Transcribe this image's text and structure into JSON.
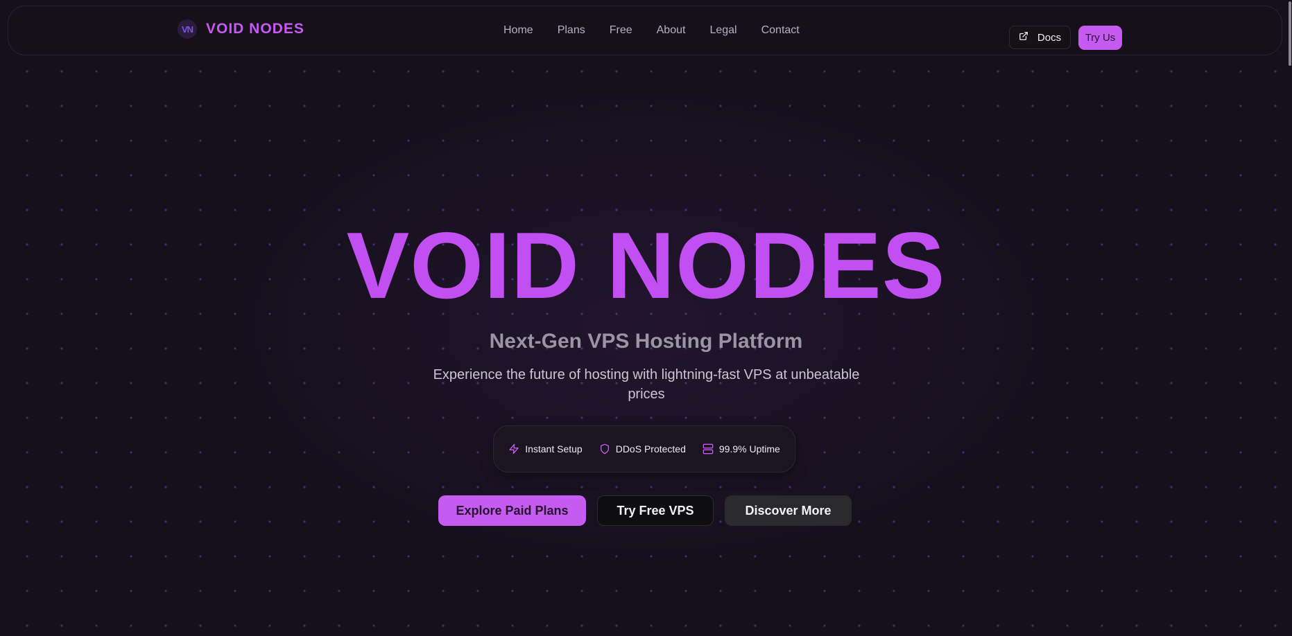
{
  "nav": {
    "logo_mark": "VN",
    "brand": "VOID NODES",
    "links": [
      "Home",
      "Plans",
      "Free",
      "About",
      "Legal",
      "Contact"
    ],
    "docs_label": "Docs",
    "try_label": "Try Us"
  },
  "hero": {
    "title": "VOID NODES",
    "subtitle": "Next-Gen VPS Hosting Platform",
    "description": "Experience the future of hosting with lightning-fast VPS at unbeatable prices",
    "features": [
      {
        "icon": "lightning-icon",
        "label": "Instant Setup"
      },
      {
        "icon": "shield-icon",
        "label": "DDoS Protected"
      },
      {
        "icon": "server-icon",
        "label": "99.9% Uptime"
      }
    ],
    "buttons": {
      "paid": "Explore Paid Plans",
      "free": "Try Free VPS",
      "more": "Discover More"
    }
  },
  "colors": {
    "accent": "#c65bf2",
    "background": "#15101c"
  }
}
